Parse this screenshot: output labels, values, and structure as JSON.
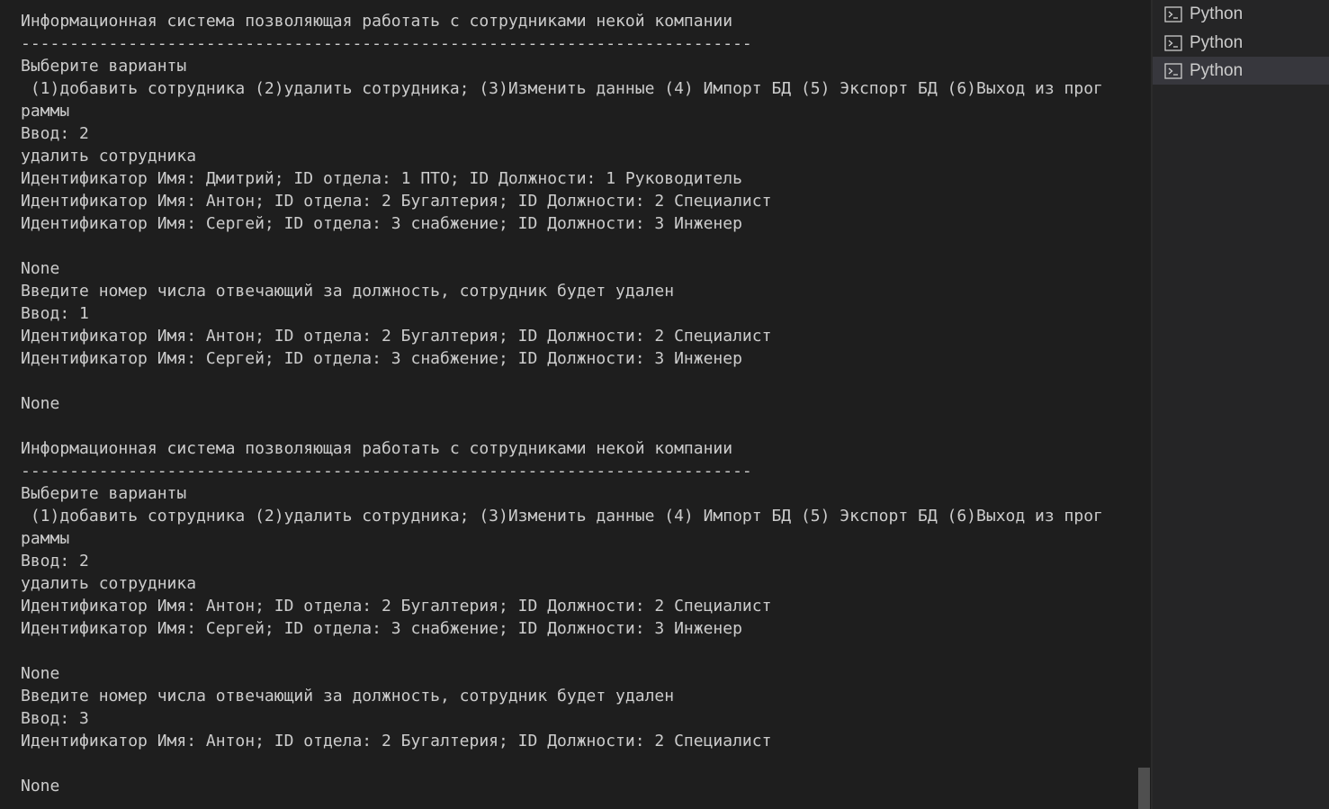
{
  "terminal": {
    "lines": [
      "Информационная система позволяющая работать с сотрудниками некой компании",
      "---------------------------------------------------------------------------",
      "Выберите варианты",
      " (1)добавить сотрудника (2)удалить сотрудника; (3)Изменить данные (4) Импорт БД (5) Экспорт БД (6)Выход из прог",
      "раммы",
      "Ввод: 2",
      "удалить сотрудника",
      "Идентификатор Имя: Дмитрий; ID отдела: 1 ПТО; ID Должности: 1 Руководитель",
      "Идентификатор Имя: Антон; ID отдела: 2 Бугалтерия; ID Должности: 2 Специалист",
      "Идентификатор Имя: Сергей; ID отдела: 3 снабжение; ID Должности: 3 Инженер",
      "",
      "None",
      "Введите номер числа отвечающий за должность, сотрудник будет удален",
      "Ввод: 1",
      "Идентификатор Имя: Антон; ID отдела: 2 Бугалтерия; ID Должности: 2 Специалист",
      "Идентификатор Имя: Сергей; ID отдела: 3 снабжение; ID Должности: 3 Инженер",
      "",
      "None",
      "",
      "Информационная система позволяющая работать с сотрудниками некой компании",
      "---------------------------------------------------------------------------",
      "Выберите варианты",
      " (1)добавить сотрудника (2)удалить сотрудника; (3)Изменить данные (4) Импорт БД (5) Экспорт БД (6)Выход из прог",
      "раммы",
      "Ввод: 2",
      "удалить сотрудника",
      "Идентификатор Имя: Антон; ID отдела: 2 Бугалтерия; ID Должности: 2 Специалист",
      "Идентификатор Имя: Сергей; ID отдела: 3 снабжение; ID Должности: 3 Инженер",
      "",
      "None",
      "Введите номер числа отвечающий за должность, сотрудник будет удален",
      "Ввод: 3",
      "Идентификатор Имя: Антон; ID отдела: 2 Бугалтерия; ID Должности: 2 Специалист",
      "",
      "None"
    ]
  },
  "terminal_tabs": [
    {
      "label": "Python",
      "icon": "terminal-icon",
      "active": false
    },
    {
      "label": "Python",
      "icon": "terminal-icon",
      "active": false
    },
    {
      "label": "Python",
      "icon": "terminal-icon",
      "active": true
    }
  ],
  "colors": {
    "background": "#1e1e1e",
    "text": "#cccccc",
    "tabs_background": "#252526",
    "active_tab": "#37373d",
    "scrollbar_thumb": "#4f4f4f"
  }
}
